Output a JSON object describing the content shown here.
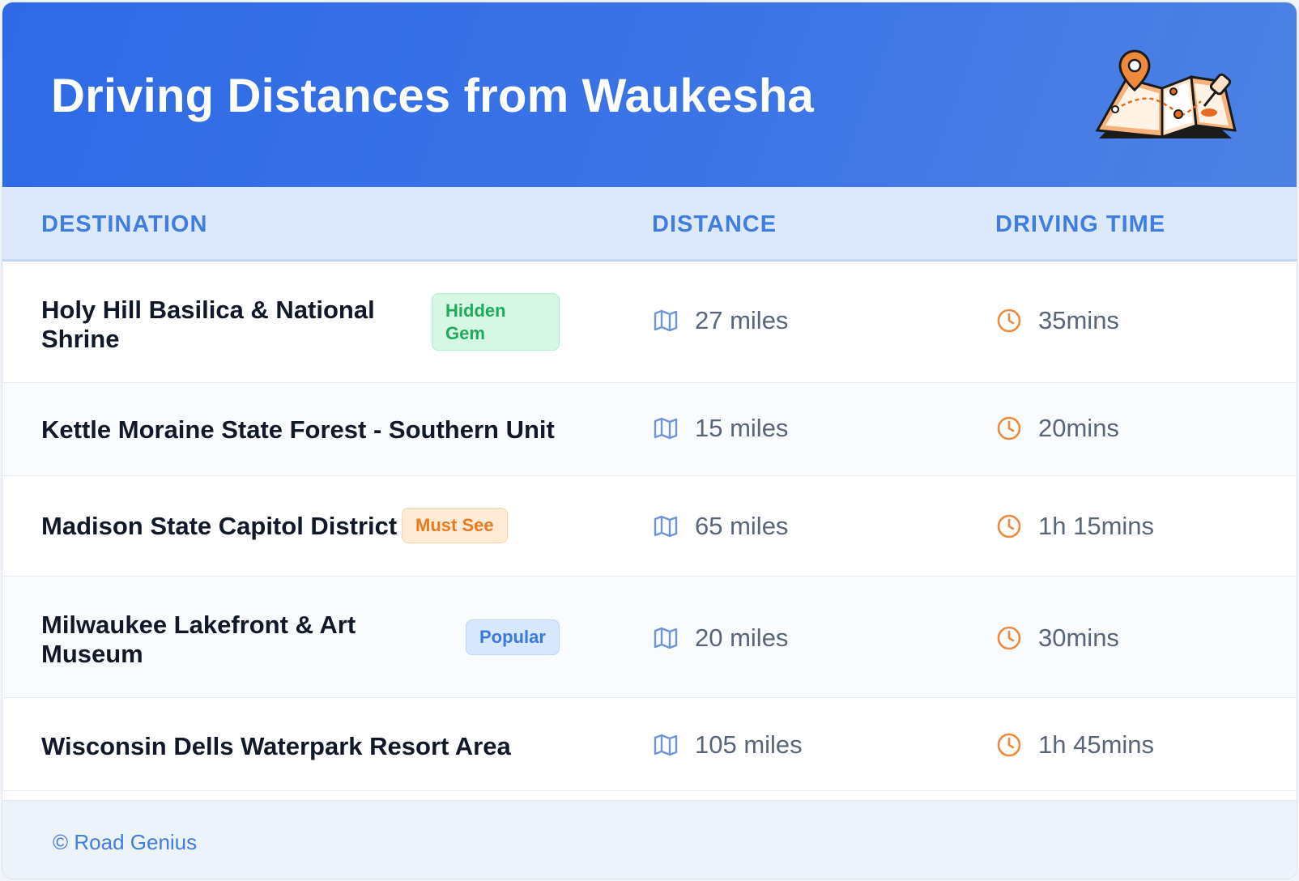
{
  "header": {
    "title": "Driving Distances from Waukesha",
    "illustration_icon": "map-pin-illustration"
  },
  "table": {
    "columns": [
      "DESTINATION",
      "DISTANCE",
      "DRIVING TIME"
    ],
    "rows": [
      {
        "destination": "Holy Hill Basilica & National Shrine",
        "badge": "Hidden Gem",
        "distance": "27 miles",
        "time": "35mins"
      },
      {
        "destination": "Kettle Moraine State Forest - Southern Unit",
        "badge": "",
        "distance": "15 miles",
        "time": "20mins"
      },
      {
        "destination": "Madison State Capitol District",
        "badge": "Must See",
        "distance": "65 miles",
        "time": "1h 15mins"
      },
      {
        "destination": "Milwaukee Lakefront & Art Museum",
        "badge": "Popular",
        "distance": "20 miles",
        "time": "30mins"
      },
      {
        "destination": "Wisconsin Dells Waterpark Resort Area",
        "badge": "",
        "distance": "105 miles",
        "time": "1h 45mins"
      }
    ]
  },
  "footer": {
    "credit": "© Road Genius"
  },
  "colors": {
    "header": "#2f6ae6",
    "accent": "#3f7de0",
    "icon_orange": "#ef8a3c",
    "icon_blue": "#6f94d8"
  }
}
